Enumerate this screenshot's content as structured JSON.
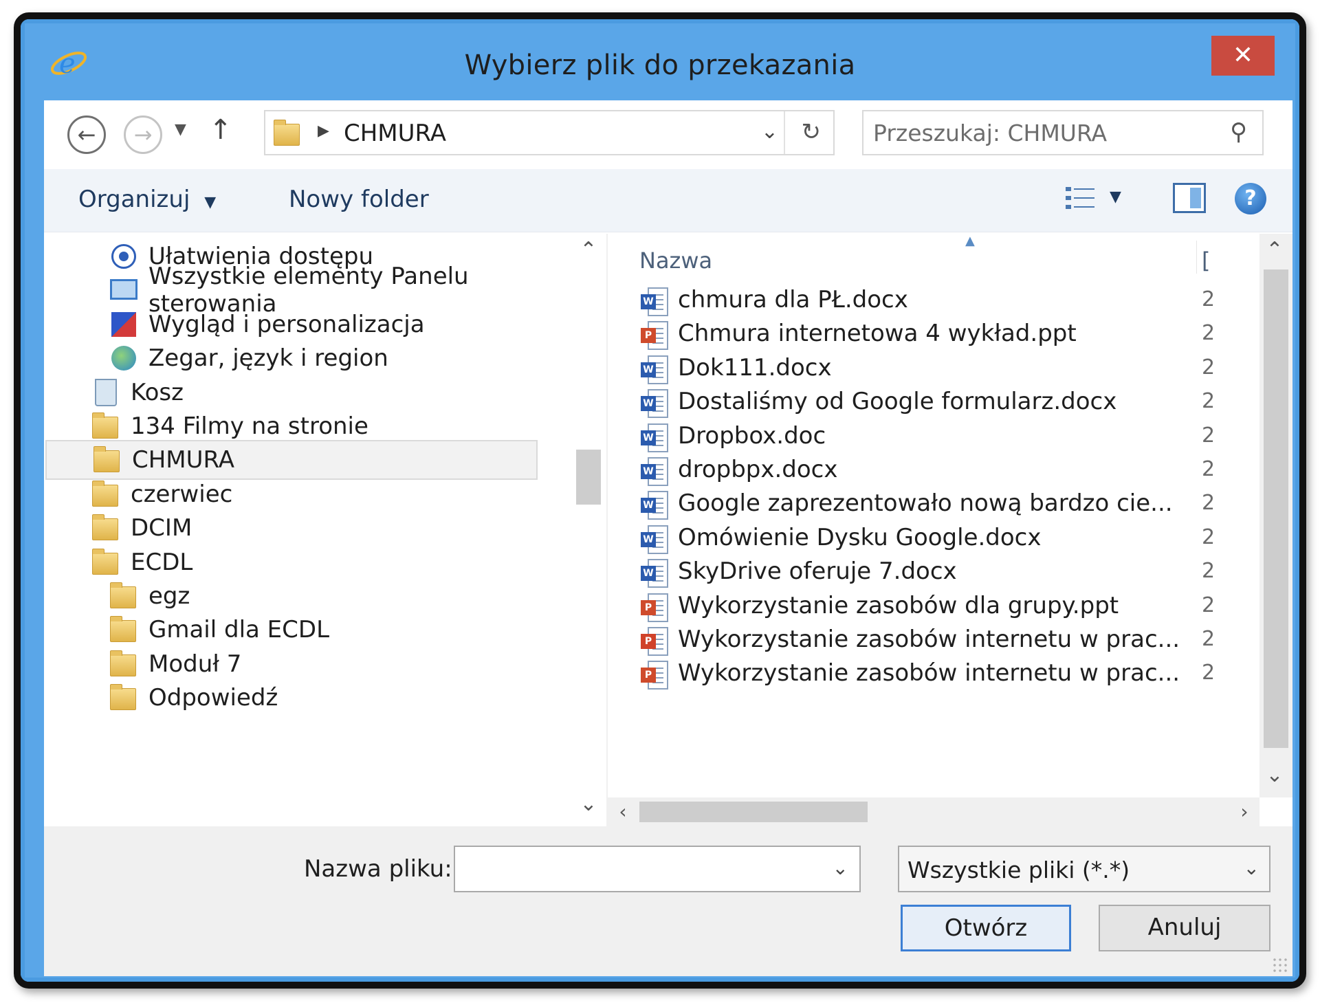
{
  "window": {
    "title": "Wybierz plik do przekazania",
    "close_label": "✕",
    "accent_color": "#5aa6e8",
    "close_color": "#c94b40"
  },
  "nav": {
    "back_icon": "back-arrow-icon",
    "forward_icon": "forward-arrow-icon",
    "recent_icon": "chevron-down-icon",
    "up_icon": "up-arrow-icon",
    "address_path": "CHMURA",
    "search_placeholder": "Przeszukaj: CHMURA"
  },
  "toolbar": {
    "organize_label": "Organizuj",
    "new_folder_label": "Nowy folder"
  },
  "tree": {
    "items": [
      {
        "label": "Ułatwienia dostępu",
        "icon": "accessibility-icon",
        "indent": 2
      },
      {
        "label": "Wszystkie elementy Panelu sterowania",
        "icon": "control-panel-icon",
        "indent": 2
      },
      {
        "label": "Wygląd i personalizacja",
        "icon": "personalization-icon",
        "indent": 2
      },
      {
        "label": "Zegar, język i region",
        "icon": "globe-icon",
        "indent": 2
      },
      {
        "label": "Kosz",
        "icon": "recycle-bin-icon",
        "indent": 1
      },
      {
        "label": "134 Filmy na stronie",
        "icon": "folder-icon",
        "indent": 1
      },
      {
        "label": "CHMURA",
        "icon": "folder-icon",
        "indent": 1,
        "selected": true
      },
      {
        "label": "czerwiec",
        "icon": "folder-icon",
        "indent": 1
      },
      {
        "label": "DCIM",
        "icon": "folder-icon",
        "indent": 1
      },
      {
        "label": "ECDL",
        "icon": "folder-icon",
        "indent": 1
      },
      {
        "label": "egz",
        "icon": "folder-icon",
        "indent": 2
      },
      {
        "label": "Gmail dla ECDL",
        "icon": "folder-icon",
        "indent": 2
      },
      {
        "label": "Moduł 7",
        "icon": "folder-icon",
        "indent": 2
      },
      {
        "label": "Odpowiedź",
        "icon": "folder-icon",
        "indent": 2
      }
    ]
  },
  "files": {
    "column_name": "Nazwa",
    "column_date_stub": "[",
    "items": [
      {
        "name": "chmura dla PŁ.docx",
        "type": "word",
        "date_stub": "2"
      },
      {
        "name": "Chmura internetowa  4 wykład.ppt",
        "type": "ppt",
        "date_stub": "2"
      },
      {
        "name": "Dok111.docx",
        "type": "word",
        "date_stub": "2"
      },
      {
        "name": "Dostaliśmy od Google formularz.docx",
        "type": "word",
        "date_stub": "2"
      },
      {
        "name": "Dropbox.doc",
        "type": "word",
        "date_stub": "2"
      },
      {
        "name": "dropbpx.docx",
        "type": "word",
        "date_stub": "2"
      },
      {
        "name": "Google zaprezentowało nową bardzo cie...",
        "type": "word",
        "date_stub": "2"
      },
      {
        "name": "Omówienie Dysku Google.docx",
        "type": "word",
        "date_stub": "2"
      },
      {
        "name": "SkyDrive oferuje 7.docx",
        "type": "word",
        "date_stub": "2"
      },
      {
        "name": "Wykorzystanie zasobów dla grupy.ppt",
        "type": "ppt",
        "date_stub": "2"
      },
      {
        "name": "Wykorzystanie zasobów internetu w prac...",
        "type": "pptx",
        "date_stub": "2"
      },
      {
        "name": "Wykorzystanie zasobów internetu w prac...",
        "type": "ppt",
        "date_stub": "2"
      }
    ]
  },
  "bottom": {
    "filename_label": "Nazwa pliku:",
    "filename_value": "",
    "filter_value": "Wszystkie pliki (*.*)",
    "open_label": "Otwórz",
    "cancel_label": "Anuluj"
  }
}
